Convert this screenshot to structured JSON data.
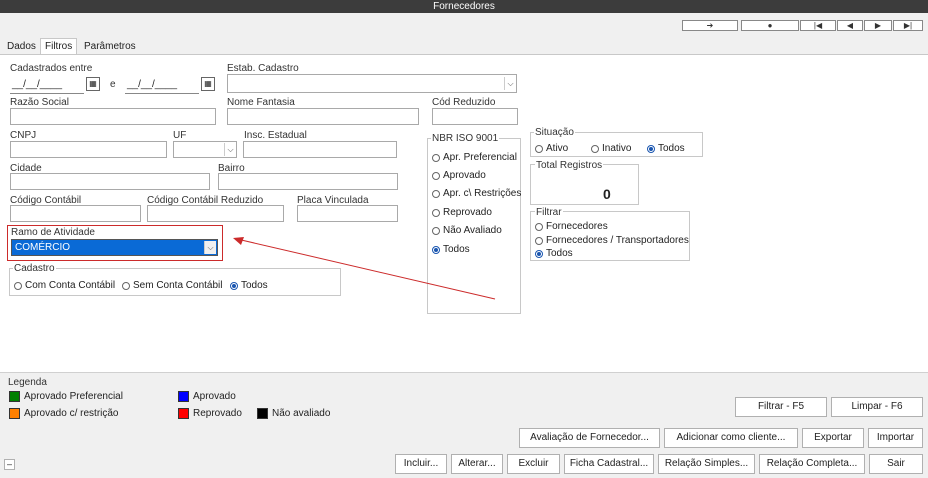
{
  "window": {
    "title": "Fornecedores"
  },
  "navigation": {
    "buttons": [
      "➔",
      "●",
      "|◀",
      "◀",
      "▶",
      "▶|"
    ]
  },
  "tabs": [
    {
      "label": "Dados"
    },
    {
      "label": "Filtros"
    },
    {
      "label": "Parâmetros"
    }
  ],
  "filters": {
    "cadastrados_entre_label": "Cadastrados entre",
    "date_from_value": "__/__/____",
    "date_connector": "e",
    "date_to_value": "__/__/____",
    "estab_cadastro_label": "Estab. Cadastro",
    "razao_social_label": "Razão Social",
    "nome_fantasia_label": "Nome Fantasia",
    "cod_reduzido_label": "Cód Reduzido",
    "cnpj_label": "CNPJ",
    "uf_label": "UF",
    "insc_estadual_label": "Insc. Estadual",
    "cidade_label": "Cidade",
    "bairro_label": "Bairro",
    "codigo_contabil_label": "Código Contábil",
    "codigo_contabil_reduzido_label": "Código Contábil Reduzido",
    "placa_vinculada_label": "Placa Vinculada",
    "ramo_atividade_label": "Ramo de Atividade",
    "ramo_atividade_value": "COMÉRCIO",
    "cadastro": {
      "title": "Cadastro",
      "options": [
        "Com Conta Contábil",
        "Sem Conta Contábil",
        "Todos"
      ],
      "selected": "Todos"
    },
    "nbr_iso": {
      "title": "NBR ISO 9001",
      "options": [
        "Apr. Preferencial",
        "Aprovado",
        "Apr. c\\ Restrições",
        "Reprovado",
        "Não Avaliado",
        "Todos"
      ],
      "selected": "Todos"
    },
    "situacao": {
      "title": "Situação",
      "options": [
        "Ativo",
        "Inativo",
        "Todos"
      ],
      "selected": "Todos"
    },
    "total_registros": {
      "title": "Total Registros",
      "value": "0"
    },
    "filtrar": {
      "title": "Filtrar",
      "options": [
        "Fornecedores",
        "Fornecedores / Transportadores",
        "Todos"
      ],
      "selected": "Todos"
    }
  },
  "legend": {
    "title": "Legenda",
    "items": [
      {
        "label": "Aprovado Preferencial",
        "color": "#008000"
      },
      {
        "label": "Aprovado",
        "color": "#0000ff"
      },
      {
        "label": "Aprovado c/ restrição",
        "color": "#ff8000"
      },
      {
        "label": "Reprovado",
        "color": "#ff0000"
      },
      {
        "label": "Não avaliado",
        "color": "#000000"
      }
    ]
  },
  "actions": {
    "filtrar": "Filtrar - F5",
    "limpar": "Limpar - F6",
    "avaliacao": "Avaliação de Fornecedor...",
    "adicionar_cliente": "Adicionar como cliente...",
    "exportar": "Exportar",
    "importar": "Importar",
    "incluir": "Incluir...",
    "alterar": "Alterar...",
    "excluir": "Excluir",
    "ficha_cadastral": "Ficha Cadastral...",
    "relacao_simples": "Relação Simples...",
    "relacao_completa": "Relação Completa...",
    "sair": "Sair",
    "minimize": "–"
  },
  "colors": {
    "selection_blue": "#0a6ad6",
    "annotation_red": "#cc2b2b",
    "title_bg": "#3c3c3c"
  }
}
